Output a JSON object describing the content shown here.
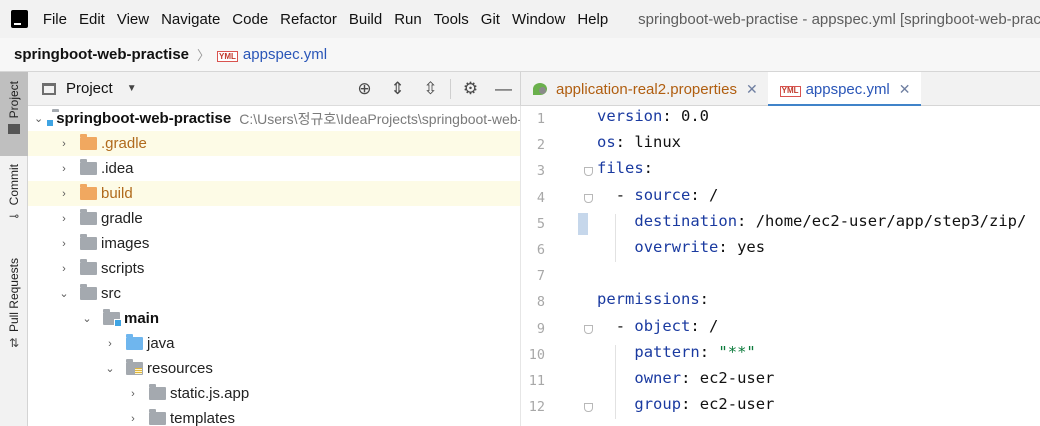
{
  "menubar": {
    "items": [
      "File",
      "Edit",
      "View",
      "Navigate",
      "Code",
      "Refactor",
      "Build",
      "Run",
      "Tools",
      "Git",
      "Window",
      "Help"
    ],
    "window_title": "springboot-web-practise - appspec.yml [springboot-web-practise]"
  },
  "navbar": {
    "project": "springboot-web-practise",
    "file_badge": "YML",
    "file": "appspec.yml"
  },
  "toolstrip": {
    "project": "Project",
    "commit": "Commit",
    "pull_requests": "Pull Requests"
  },
  "project_panel": {
    "title": "Project",
    "root": {
      "name": "springboot-web-practise",
      "path": "C:\\Users\\정규호\\IdeaProjects\\springboot-web-practise"
    },
    "items": [
      {
        "label": "gradle",
        "display": ".gradle",
        "depth": 1,
        "expanded": false,
        "folder": "orange",
        "highlighted": true
      },
      {
        "label": "idea",
        "display": ".idea",
        "depth": 1,
        "expanded": false,
        "folder": "grey",
        "highlighted": false
      },
      {
        "label": "build",
        "display": "build",
        "depth": 1,
        "expanded": false,
        "folder": "orange",
        "highlighted": true
      },
      {
        "label": "gradle-dir",
        "display": "gradle",
        "depth": 1,
        "expanded": false,
        "folder": "grey",
        "highlighted": false
      },
      {
        "label": "images",
        "display": "images",
        "depth": 1,
        "expanded": false,
        "folder": "grey",
        "highlighted": false
      },
      {
        "label": "scripts",
        "display": "scripts",
        "depth": 1,
        "expanded": false,
        "folder": "grey",
        "highlighted": false
      },
      {
        "label": "src",
        "display": "src",
        "depth": 1,
        "expanded": true,
        "folder": "grey",
        "highlighted": false
      },
      {
        "label": "main",
        "display": "main",
        "depth": 2,
        "expanded": true,
        "folder": "module",
        "highlighted": false,
        "bold": true
      },
      {
        "label": "java",
        "display": "java",
        "depth": 3,
        "expanded": false,
        "folder": "blue",
        "highlighted": false
      },
      {
        "label": "resources",
        "display": "resources",
        "depth": 3,
        "expanded": true,
        "folder": "resources",
        "highlighted": false
      },
      {
        "label": "static-js-app",
        "display": "static.js.app",
        "depth": 4,
        "expanded": false,
        "folder": "grey",
        "highlighted": false
      },
      {
        "label": "templates",
        "display": "templates",
        "depth": 4,
        "expanded": false,
        "folder": "grey",
        "highlighted": false
      }
    ]
  },
  "tabs": [
    {
      "label": "application-real2.properties",
      "active": false,
      "kind": "properties"
    },
    {
      "label": "appspec.yml",
      "active": true,
      "kind": "yml",
      "badge": "YML"
    }
  ],
  "editor": {
    "lines": [
      {
        "n": "1",
        "indent": 0,
        "key": "version",
        "value": " 0.0"
      },
      {
        "n": "2",
        "indent": 0,
        "key": "os",
        "value": " linux"
      },
      {
        "n": "3",
        "indent": 0,
        "key": "files",
        "value": ""
      },
      {
        "n": "4",
        "indent": 1,
        "dash": true,
        "key": "source",
        "value": " /"
      },
      {
        "n": "5",
        "indent": 2,
        "key": "destination",
        "value": " /home/ec2-user/app/step3/zip/"
      },
      {
        "n": "6",
        "indent": 2,
        "key": "overwrite",
        "value": " yes"
      },
      {
        "n": "7",
        "indent": 0,
        "key": "",
        "value": ""
      },
      {
        "n": "8",
        "indent": 0,
        "key": "permissions",
        "value": ""
      },
      {
        "n": "9",
        "indent": 1,
        "dash": true,
        "key": "object",
        "value": " /"
      },
      {
        "n": "10",
        "indent": 2,
        "key": "pattern",
        "value": " ",
        "string": "\"**\""
      },
      {
        "n": "11",
        "indent": 2,
        "key": "owner",
        "value": " ec2-user"
      },
      {
        "n": "12",
        "indent": 2,
        "key": "group",
        "value": " ec2-user"
      }
    ]
  },
  "colors": {
    "key": "#1a3aa0",
    "string": "#0b7a3b",
    "active_tab_underline": "#4083c9",
    "highlight_row": "#fdfbe6"
  }
}
